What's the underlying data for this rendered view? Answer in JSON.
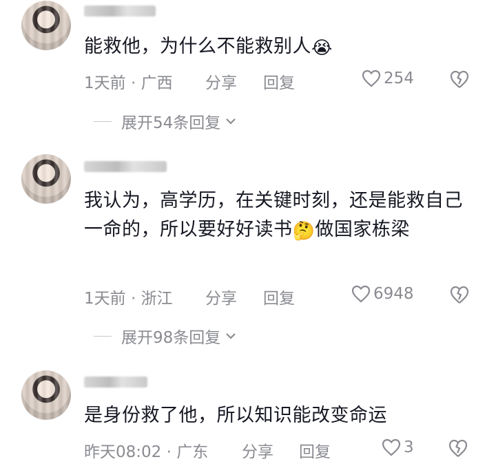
{
  "comments": [
    {
      "text": "能救他，为什么不能救别人",
      "emoji": "😭",
      "time_location": "1天前 · 广西",
      "share": "分享",
      "reply": "回复",
      "likes": "254",
      "expand": "展开54条回复"
    },
    {
      "text": "我认为，高学历，在关键时刻，还是能救自己一命的，所以要好好读书",
      "emoji": "🤔",
      "text_after": "做国家栋梁",
      "time_location": "1天前 · 浙江",
      "share": "分享",
      "reply": "回复",
      "likes": "6948",
      "expand": "展开98条回复"
    },
    {
      "text": "是身份救了他，所以知识能改变命运",
      "time_location": "昨天08:02 · 广东",
      "share": "分享",
      "reply": "回复",
      "likes": "3"
    }
  ],
  "icons": {
    "like": "heart-outline-icon",
    "dislike": "broken-heart-icon",
    "expand": "chevron-down-icon"
  }
}
